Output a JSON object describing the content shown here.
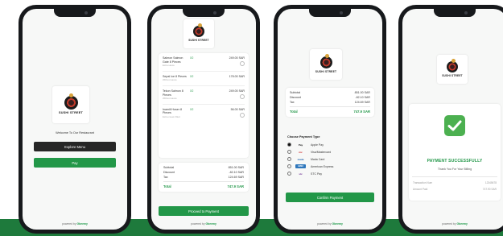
{
  "brand": {
    "name": "SUSHI STREET",
    "powered_by_prefix": "powered by",
    "powered_by_brand": "Gbeemy"
  },
  "screen1": {
    "welcome": "Welcome To Our Restaurant",
    "explore_label": "Explore Menu",
    "pay_label": "Pay"
  },
  "screen2": {
    "items": [
      {
        "name": "Salmon Salmon Gate 8 Pieces",
        "sub": "Extra sauce",
        "qty": "X2",
        "price": "249.00 SAR"
      },
      {
        "name": "Sepal Ice 8 Pieces",
        "sub": "Without sauce",
        "qty": "X2",
        "price": "178.00 SAR"
      },
      {
        "name": "Tekon Salmon 8 Pieces",
        "sub": "Without sauce",
        "qty": "X2",
        "price": "249.00 SAR"
      },
      {
        "name": "Inamili Hoser 8 Pieces",
        "sub": "Extra cream filled",
        "qty": "X2",
        "price": "56.00 SAR"
      }
    ],
    "summary": [
      {
        "label": "Subtotal",
        "value": "851.00 SAR"
      },
      {
        "label": "Discount",
        "value": "-82.10 SAR"
      },
      {
        "label": "Tax",
        "value": "124.69 SAR"
      }
    ],
    "total_label": "Total",
    "total_value": "747.9 SAR",
    "proceed_label": "Proceed to Payment"
  },
  "screen3": {
    "summary": [
      {
        "label": "Subtotal",
        "value": "851.00 SAR"
      },
      {
        "label": "Discount",
        "value": "-82.10 SAR"
      },
      {
        "label": "Tax",
        "value": "124.69 SAR"
      }
    ],
    "total_label": "Total",
    "total_value": "747.9 SAR",
    "payment_heading": "Choose Payment Type",
    "payment_options": [
      {
        "icon_text": "Pay",
        "label": "Apple Pay",
        "selected": true
      },
      {
        "icon_text": "mc",
        "label": "Visa/Mastercard",
        "selected": false
      },
      {
        "icon_text": "mada",
        "label": "Mada Card",
        "selected": false
      },
      {
        "icon_text": "AMEX",
        "label": "American Express",
        "selected": false
      },
      {
        "icon_text": "stc",
        "label": "STC Pay",
        "selected": false
      }
    ],
    "confirm_label": "Confirm Payment"
  },
  "screen4": {
    "success_title": "PAYMENT SUCCESSFULLY",
    "thanks": "Thank You For Your Billing",
    "details": [
      {
        "label": "Transaction Num",
        "value": "12345678"
      },
      {
        "label": "Amount Paid",
        "value": "747.90 SAR"
      }
    ]
  },
  "colors": {
    "accent_green": "#229748",
    "band_green": "#1e7a3c",
    "success_green": "#4cb050",
    "phone_frame": "#17191c"
  }
}
